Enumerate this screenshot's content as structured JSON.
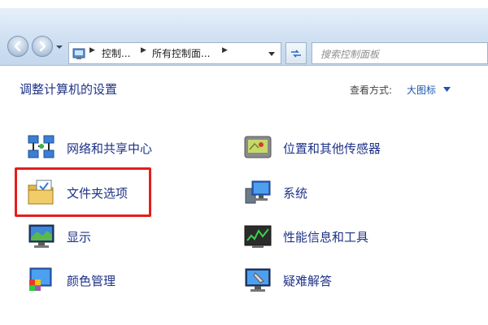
{
  "addressbar": {
    "breadcrumb": [
      "控制...",
      "所有控制面..."
    ],
    "search_placeholder": "搜索控制面板"
  },
  "header": {
    "title": "调整计算机的设置",
    "view_label": "查看方式:",
    "view_value": "大图标"
  },
  "items": [
    {
      "label": "网络和共享中心",
      "icon": "network-sharing-icon"
    },
    {
      "label": "位置和其他传感器",
      "icon": "location-sensors-icon"
    },
    {
      "label": "文件夹选项",
      "icon": "folder-options-icon"
    },
    {
      "label": "系统",
      "icon": "system-icon"
    },
    {
      "label": "显示",
      "icon": "display-icon"
    },
    {
      "label": "性能信息和工具",
      "icon": "performance-icon"
    },
    {
      "label": "颜色管理",
      "icon": "color-management-icon"
    },
    {
      "label": "疑难解答",
      "icon": "troubleshooting-icon"
    }
  ],
  "highlighted_item": "文件夹选项",
  "colors": {
    "link_text": "#1e3287",
    "highlight_border": "#e41d1d",
    "addressbar_bg": "#cfe0f2"
  }
}
